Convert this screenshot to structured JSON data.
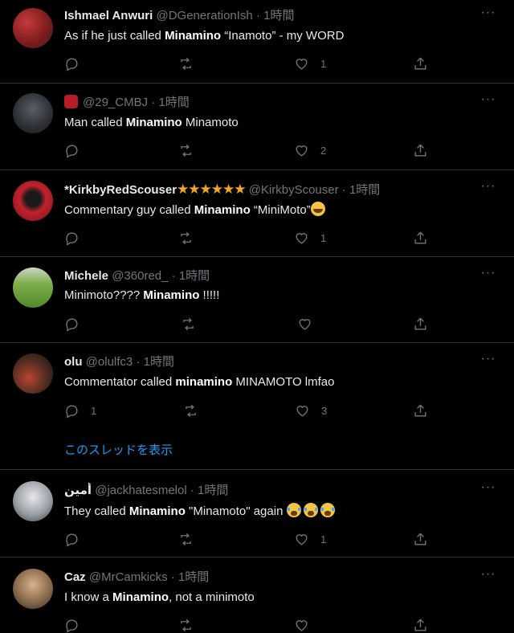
{
  "tweets": [
    {
      "display_name": "Ishmael Anwuri",
      "handle": "@DGenerationIsh",
      "time": "1時間",
      "text_before": "As if he just called ",
      "text_bold": "Minamino",
      "text_after": " “Inamoto” - my WORD",
      "reply_count": "",
      "like_count": "1"
    },
    {
      "display_name": "",
      "handle": "@29_CMBJ",
      "time": "1時間",
      "text_before": "Man called ",
      "text_bold": "Minamino",
      "text_after": " Minamoto",
      "reply_count": "",
      "like_count": "2"
    },
    {
      "display_name": "*KirkbyRedScouser",
      "handle": "@KirkbyScouser",
      "time": "1時間",
      "stars": "★★★★★★",
      "text_before": "Commentary guy called ",
      "text_bold": "Minamino",
      "text_after": " “MiniMoto”",
      "reply_count": "",
      "like_count": "1"
    },
    {
      "display_name": "Michele",
      "handle": "@360red_",
      "time": "1時間",
      "text_before": "Minimoto???? ",
      "text_bold": "Minamino",
      "text_after": " !!!!!",
      "reply_count": "",
      "like_count": ""
    },
    {
      "display_name": "olu",
      "handle": "@olulfc3",
      "time": "1時間",
      "text_before": "Commentator called ",
      "text_bold": "minamino",
      "text_after": " MINAMOTO lmfao",
      "reply_count": "1",
      "like_count": "3"
    },
    {
      "display_name": "أمين",
      "handle": "@jackhatesmelol",
      "time": "1時間",
      "text_before": "They called ",
      "text_bold": "Minamino",
      "text_after": " \"Minamoto\" again ",
      "reply_count": "",
      "like_count": "1"
    },
    {
      "display_name": "Caz",
      "handle": "@MrCamkicks",
      "time": "1時間",
      "text_before": "I know a ",
      "text_bold": "Minamino",
      "text_after": ", not a minimoto",
      "reply_count": "",
      "like_count": ""
    }
  ],
  "dot": "·",
  "more_glyph": "···",
  "show_thread": "このスレッドを表示",
  "colors": {
    "link": "#1d9bf0",
    "muted": "#71767b",
    "star": "#f5a623"
  }
}
